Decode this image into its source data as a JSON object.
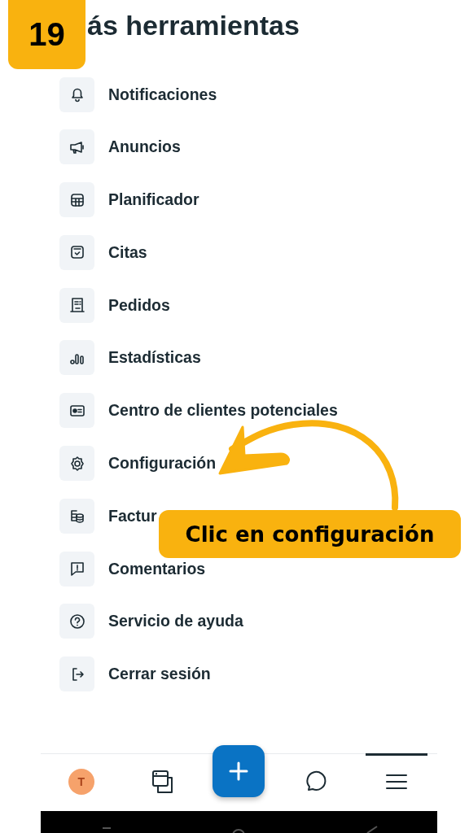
{
  "title": "ás herramientas",
  "step_badge": "19",
  "items": [
    {
      "label": "Notificaciones"
    },
    {
      "label": "Anuncios"
    },
    {
      "label": "Planificador"
    },
    {
      "label": "Citas"
    },
    {
      "label": "Pedidos"
    },
    {
      "label": "Estadísticas"
    },
    {
      "label": "Centro de clientes potenciales"
    },
    {
      "label": "Configuración"
    },
    {
      "label": "Factur"
    },
    {
      "label": "Comentarios"
    },
    {
      "label": "Servicio de ayuda"
    },
    {
      "label": "Cerrar sesión"
    }
  ],
  "callout": "Clic en configuración",
  "nav": [
    {
      "kind": "avatar",
      "initial": "T",
      "selected": false
    },
    {
      "kind": "pages",
      "selected": false
    },
    {
      "kind": "create"
    },
    {
      "kind": "chat",
      "selected": false
    },
    {
      "kind": "menu",
      "selected": true
    }
  ]
}
